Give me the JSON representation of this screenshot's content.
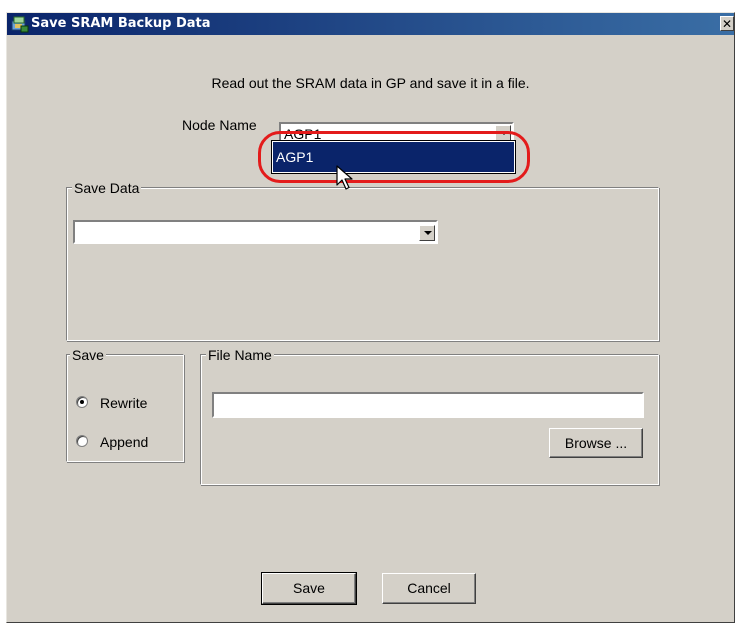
{
  "window": {
    "title": "Save SRAM Backup Data",
    "close_glyph": "✕"
  },
  "instruction": "Read out the SRAM data in GP and save it in a file.",
  "node": {
    "label": "Node Name",
    "value": "AGP1",
    "dropdown_options": [
      "AGP1"
    ],
    "highlighted_option": "AGP1"
  },
  "save_data": {
    "group_label": "Save Data",
    "value": ""
  },
  "save_mode": {
    "group_label": "Save",
    "options": [
      {
        "label": "Rewrite",
        "checked": true
      },
      {
        "label": "Append",
        "checked": false
      }
    ]
  },
  "file_name": {
    "group_label": "File Name",
    "value": "",
    "browse_label": "Browse ..."
  },
  "buttons": {
    "save": "Save",
    "cancel": "Cancel"
  },
  "colors": {
    "title_bar": "#0a246a",
    "highlight": "#e31b1b",
    "selection": "#0a246a",
    "dialog_bg": "#d4d0c8"
  },
  "icons": {
    "app": "sram-backup-icon",
    "close": "close-icon",
    "dropdown": "chevron-down-icon",
    "pointer": "mouse-pointer-icon"
  }
}
